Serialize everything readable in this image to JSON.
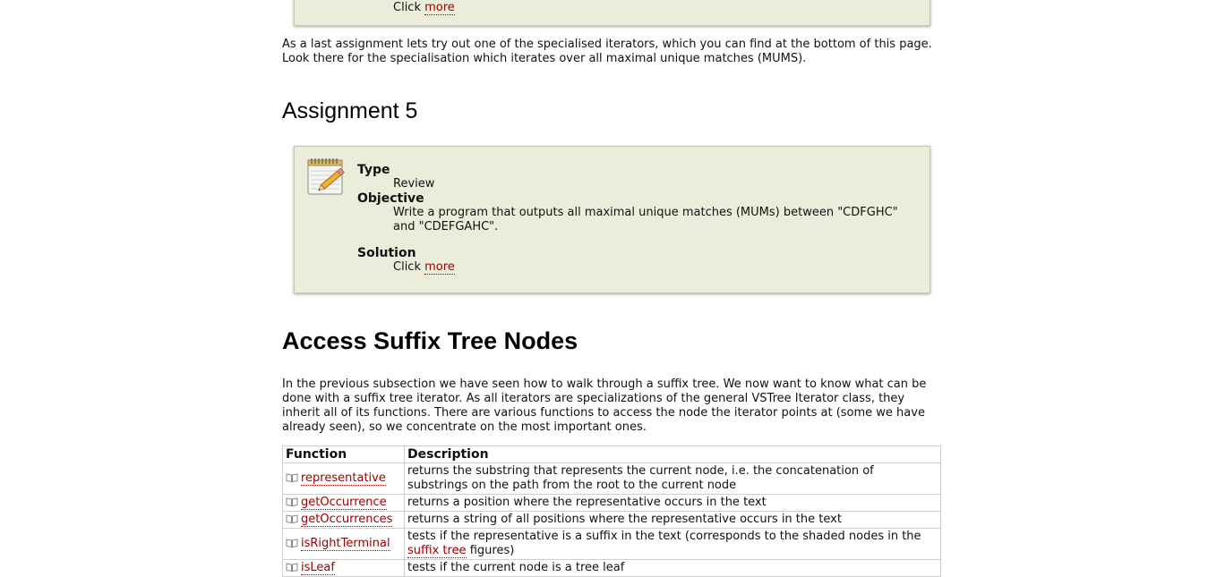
{
  "top_box": {
    "click_text": "Click",
    "more_link": "more"
  },
  "intro_paragraph": "As a last assignment lets try out one of the specialised iterators, which you can find at the bottom of this page. Look there for the specialisation which iterates over all maximal unique matches (MUMS).",
  "assignment5": {
    "heading": "Assignment 5",
    "type_label": "Type",
    "type_value": "Review",
    "objective_label": "Objective",
    "objective_value": "Write a program that outputs all maximal unique matches (MUMs) between \"CDFGHC\" and \"CDEFGAHC\".",
    "solution_label": "Solution",
    "solution_click": "Click",
    "solution_more": "more",
    "icon": "notepad-pencil-icon"
  },
  "access_section": {
    "heading": "Access Suffix Tree Nodes",
    "paragraph": "In the previous subsection we have seen how to walk through a suffix tree. We now want to know what can be done with a suffix tree iterator. As all iterators are specializations of the general VSTree Iterator class, they inherit all of its functions. There are various functions to access the node the iterator points at (some we have already seen), so we concentrate on the most important ones."
  },
  "function_table": {
    "headers": [
      "Function",
      "Description"
    ],
    "rows": [
      {
        "function": "representative",
        "description": "returns the substring that represents the current node, i.e. the concatenation of substrings on the path from the root to the current node"
      },
      {
        "function": "getOccurrence",
        "description": "returns a position where the representative occurs in the text"
      },
      {
        "function": "getOccurrences",
        "description": "returns a string of all positions where the representative occurs in the text"
      },
      {
        "function": "isRightTerminal",
        "description_before": "tests if the representative is a suffix in the text (corresponds to the shaded nodes in the",
        "description_link": "suffix tree",
        "description_after": "figures)"
      },
      {
        "function": "isLeaf",
        "description": "tests if the current node is a tree leaf"
      }
    ]
  },
  "colors": {
    "link": "#a00000",
    "box_bg": "#ececdb",
    "box_border": "#c6c6b4"
  }
}
